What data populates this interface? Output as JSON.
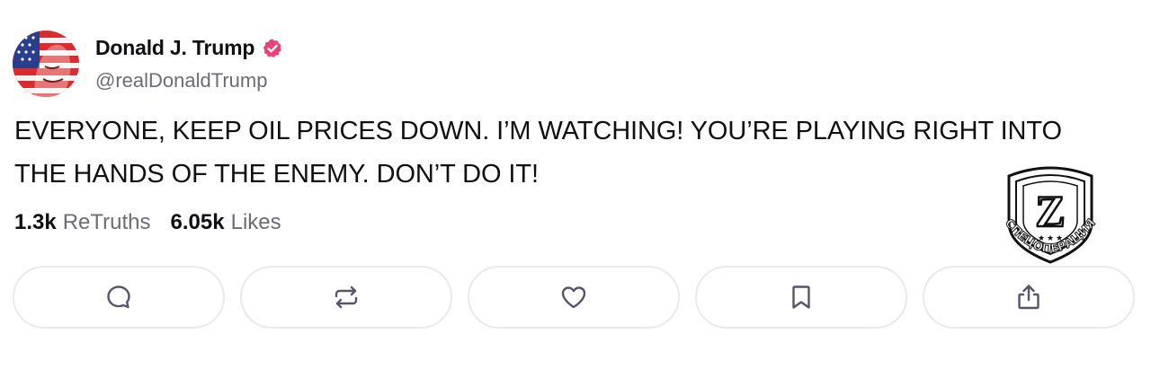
{
  "author": {
    "display_name": "Donald J. Trump",
    "handle": "@realDonaldTrump",
    "verified_badge_color": "#e8427c"
  },
  "post": {
    "line1": "EVERYONE, KEEP OIL PRICES DOWN. I’M WATCHING! YOU’RE PLAYING RIGHT INTO",
    "line2": "THE HANDS OF THE ENEMY. DON’T DO IT!"
  },
  "stats": {
    "retruths_count": "1.3k",
    "retruths_label": "ReTruths",
    "likes_count": "6.05k",
    "likes_label": "Likes"
  },
  "actions": [
    {
      "icon": "reply-icon"
    },
    {
      "icon": "retruth-icon"
    },
    {
      "icon": "like-icon"
    },
    {
      "icon": "bookmark-icon"
    },
    {
      "icon": "share-icon"
    }
  ],
  "watermark": {
    "letter": "Z",
    "text": "СПЕЦОПЕРАЦИЯ"
  },
  "colors": {
    "text": "#0f0f14",
    "muted": "#6c6c78",
    "border": "#e9e9ee",
    "icon": "#55556a"
  }
}
